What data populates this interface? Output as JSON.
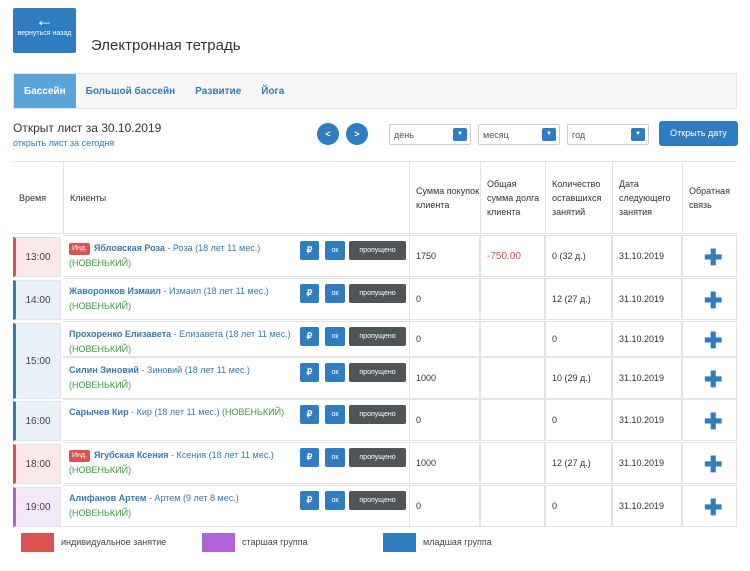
{
  "header": {
    "back_label": "вернуться назад",
    "title": "Электронная тетрадь"
  },
  "tabs": [
    {
      "label": "Бассейн",
      "active": true
    },
    {
      "label": "Большой бассейн",
      "active": false
    },
    {
      "label": "Развитие",
      "active": false
    },
    {
      "label": "Йога",
      "active": false
    }
  ],
  "sheet": {
    "title": "Открыт лист за 30.10.2019",
    "today_link": "открыть лист за сегодня",
    "prev": "<",
    "next": ">",
    "day_placeholder": "день",
    "month_placeholder": "месяц",
    "year_placeholder": "год",
    "open_button": "Открыть дату"
  },
  "columns": {
    "time": "Время",
    "clients": "Клиенты",
    "sum": "Сумма покупок клиента",
    "debt": "Общая сумма долга клиента",
    "remaining": "Количество оставшихся занятий",
    "next_date": "Дата следующего занятия",
    "feedback": "Обратная связь"
  },
  "buttons": {
    "rub": "₽",
    "ok": "ок",
    "skip": "пропущено",
    "ind_tag": "Инд."
  },
  "rows": [
    {
      "time": "13:00",
      "type": "ind",
      "ind": true,
      "name": "Ябловская Роза",
      "detail": " - Роза (18 лет 11 мес.)",
      "status": "(НОВЕНЬКИЙ)",
      "sum": "1750",
      "debt": "-750.00",
      "remaining": "0 (32 д.)",
      "next": "31.10.2019"
    },
    {
      "time": "14:00",
      "type": "jr",
      "ind": false,
      "name": "Жаворонков Измаил",
      "detail": " - Измаил (18 лет 11 мес.)",
      "status": "(НОВЕНЬКИЙ)",
      "sum": "0",
      "debt": "",
      "remaining": "12 (27 д.)",
      "next": "31.10.2019"
    },
    {
      "time": "15:00",
      "type": "jr",
      "ind": false,
      "name": "Прохоренко Елизавета",
      "detail": " - Елизавета (18 лет 11 мес.)",
      "status": "(НОВЕНЬКИЙ)",
      "sum": "0",
      "debt": "",
      "remaining": "0",
      "next": "31.10.2019"
    },
    {
      "time": "",
      "type": "jr",
      "ind": false,
      "name": "Силин Зиновий",
      "detail": " - Зиновий (18 лет 11 мес.)",
      "status": "(НОВЕНЬКИЙ)",
      "sum": "1000",
      "debt": "",
      "remaining": "10 (29 д.)",
      "next": "31.10.2019"
    },
    {
      "time": "16:00",
      "type": "jr",
      "ind": false,
      "name": "Сарычев Кир",
      "detail": " - Кир (18 лет 11 мес.)",
      "status": "(НОВЕНЬКИЙ)",
      "sum": "0",
      "debt": "",
      "remaining": "0",
      "next": "31.10.2019"
    },
    {
      "time": "18:00",
      "type": "ind",
      "ind": true,
      "name": "Ягубская Ксения",
      "detail": " - Ксения (18 лет 11 мес.)",
      "status": "(НОВЕНЬКИЙ)",
      "sum": "1000",
      "debt": "",
      "remaining": "12 (27 д.)",
      "next": "31.10.2019"
    },
    {
      "time": "19:00",
      "type": "sr",
      "ind": false,
      "name": "Алифанов Артем",
      "detail": " - Артем (9 лет 8 мес.)",
      "status": "(НОВЕНЬКИЙ)",
      "sum": "0",
      "debt": "",
      "remaining": "0",
      "next": "31.10.2019"
    }
  ],
  "legend": [
    {
      "label": "индивидуальное занятие",
      "color": "#d9534f"
    },
    {
      "label": "старшая группа",
      "color": "#b063d6"
    },
    {
      "label": "младшая группа",
      "color": "#2f7cc1"
    }
  ]
}
